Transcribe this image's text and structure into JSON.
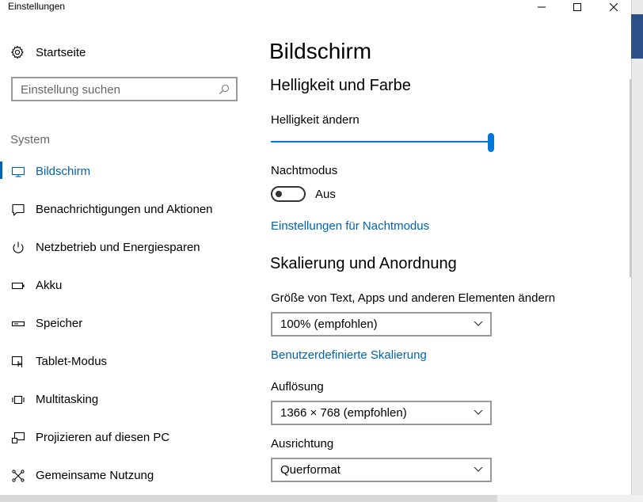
{
  "window": {
    "title": "Einstellungen"
  },
  "nav": {
    "home_label": "Startseite",
    "search_placeholder": "Einstellung suchen",
    "section": "System",
    "items": [
      {
        "label": "Bildschirm",
        "icon": "monitor-icon",
        "active": true
      },
      {
        "label": "Benachrichtigungen und Aktionen",
        "icon": "notification-icon"
      },
      {
        "label": "Netzbetrieb und Energiesparen",
        "icon": "power-icon"
      },
      {
        "label": "Akku",
        "icon": "battery-icon"
      },
      {
        "label": "Speicher",
        "icon": "storage-icon"
      },
      {
        "label": "Tablet-Modus",
        "icon": "tablet-mode-icon"
      },
      {
        "label": "Multitasking",
        "icon": "multitasking-icon"
      },
      {
        "label": "Projizieren auf diesen PC",
        "icon": "project-icon"
      },
      {
        "label": "Gemeinsame Nutzung",
        "icon": "shared-experiences-icon"
      }
    ]
  },
  "main": {
    "title": "Bildschirm",
    "brightness_section": "Helligkeit und Farbe",
    "brightness_label": "Helligkeit ändern",
    "brightness_level": 1.0,
    "night_mode_label": "Nachtmodus",
    "night_mode_state": "Aus",
    "night_mode_link": "Einstellungen für Nachtmodus",
    "scale_section": "Skalierung und Anordnung",
    "scale_label": "Größe von Text, Apps und anderen Elementen ändern",
    "scale_value": "100% (empfohlen)",
    "custom_scale_link": "Benutzerdefinierte Skalierung",
    "resolution_label": "Auflösung",
    "resolution_value": "1366 × 768 (empfohlen)",
    "orientation_label": "Ausrichtung",
    "orientation_value": "Querformat"
  },
  "colors": {
    "accent": "#0063b1",
    "slider": "#0078d7"
  }
}
